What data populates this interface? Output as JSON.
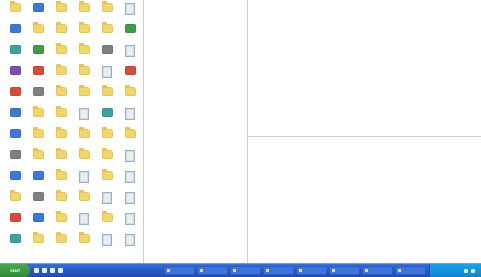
{
  "taskbar": {
    "start_label": "start",
    "quick_launch": [
      {
        "icon": "ie-icon"
      },
      {
        "icon": "desktop-icon"
      },
      {
        "icon": "media-icon"
      },
      {
        "icon": "mail-icon"
      }
    ],
    "tasks": [
      {
        "label": "",
        "icon": "folder-icon"
      },
      {
        "label": "",
        "icon": "folder-icon"
      },
      {
        "label": "",
        "icon": "folder-icon"
      },
      {
        "label": "",
        "icon": "folder-icon"
      },
      {
        "label": "",
        "icon": "folder-icon"
      },
      {
        "label": "",
        "icon": "folder-icon"
      },
      {
        "label": "",
        "icon": "folder-icon"
      },
      {
        "label": "",
        "icon": "folder-icon"
      }
    ],
    "tray": {
      "clock": ""
    }
  },
  "desktop": {
    "icons": [
      {
        "type": "folder",
        "label": ""
      },
      {
        "type": "app-blue",
        "label": ""
      },
      {
        "type": "folder",
        "label": ""
      },
      {
        "type": "folder",
        "label": ""
      },
      {
        "type": "folder",
        "label": ""
      },
      {
        "type": "doc",
        "label": ""
      },
      {
        "type": "app-blue",
        "label": ""
      },
      {
        "type": "folder",
        "label": ""
      },
      {
        "type": "folder",
        "label": ""
      },
      {
        "type": "folder",
        "label": ""
      },
      {
        "type": "folder",
        "label": ""
      },
      {
        "type": "app-green",
        "label": ""
      },
      {
        "type": "app-teal",
        "label": ""
      },
      {
        "type": "app-green",
        "label": ""
      },
      {
        "type": "folder",
        "label": ""
      },
      {
        "type": "folder",
        "label": ""
      },
      {
        "type": "app-gray",
        "label": ""
      },
      {
        "type": "doc",
        "label": ""
      },
      {
        "type": "app-purple",
        "label": ""
      },
      {
        "type": "app-red",
        "label": ""
      },
      {
        "type": "folder",
        "label": ""
      },
      {
        "type": "folder",
        "label": ""
      },
      {
        "type": "doc",
        "label": ""
      },
      {
        "type": "app-red",
        "label": ""
      },
      {
        "type": "app-red",
        "label": ""
      },
      {
        "type": "app-gray",
        "label": ""
      },
      {
        "type": "folder",
        "label": ""
      },
      {
        "type": "folder",
        "label": ""
      },
      {
        "type": "folder",
        "label": ""
      },
      {
        "type": "folder",
        "label": ""
      },
      {
        "type": "app-blue",
        "label": ""
      },
      {
        "type": "folder",
        "label": ""
      },
      {
        "type": "folder",
        "label": ""
      },
      {
        "type": "doc",
        "label": ""
      },
      {
        "type": "app-teal",
        "label": ""
      },
      {
        "type": "doc",
        "label": ""
      },
      {
        "type": "app-blue",
        "label": ""
      },
      {
        "type": "folder",
        "label": ""
      },
      {
        "type": "folder",
        "label": ""
      },
      {
        "type": "folder",
        "label": ""
      },
      {
        "type": "folder",
        "label": ""
      },
      {
        "type": "folder",
        "label": ""
      },
      {
        "type": "app-gray",
        "label": ""
      },
      {
        "type": "folder",
        "label": ""
      },
      {
        "type": "folder",
        "label": ""
      },
      {
        "type": "folder",
        "label": ""
      },
      {
        "type": "folder",
        "label": ""
      },
      {
        "type": "doc",
        "label": ""
      },
      {
        "type": "app-blue",
        "label": ""
      },
      {
        "type": "app-blue",
        "label": ""
      },
      {
        "type": "folder",
        "label": ""
      },
      {
        "type": "doc",
        "label": ""
      },
      {
        "type": "folder",
        "label": ""
      },
      {
        "type": "doc",
        "label": ""
      },
      {
        "type": "folder",
        "label": ""
      },
      {
        "type": "app-gray",
        "label": ""
      },
      {
        "type": "folder",
        "label": ""
      },
      {
        "type": "folder",
        "label": ""
      },
      {
        "type": "doc",
        "label": ""
      },
      {
        "type": "doc",
        "label": ""
      },
      {
        "type": "app-red",
        "label": ""
      },
      {
        "type": "app-blue",
        "label": ""
      },
      {
        "type": "folder",
        "label": ""
      },
      {
        "type": "doc",
        "label": ""
      },
      {
        "type": "folder",
        "label": ""
      },
      {
        "type": "doc",
        "label": ""
      },
      {
        "type": "app-teal",
        "label": ""
      },
      {
        "type": "folder",
        "label": ""
      },
      {
        "type": "folder",
        "label": ""
      },
      {
        "type": "folder",
        "label": ""
      },
      {
        "type": "doc",
        "label": ""
      },
      {
        "type": "doc",
        "label": ""
      }
    ]
  }
}
